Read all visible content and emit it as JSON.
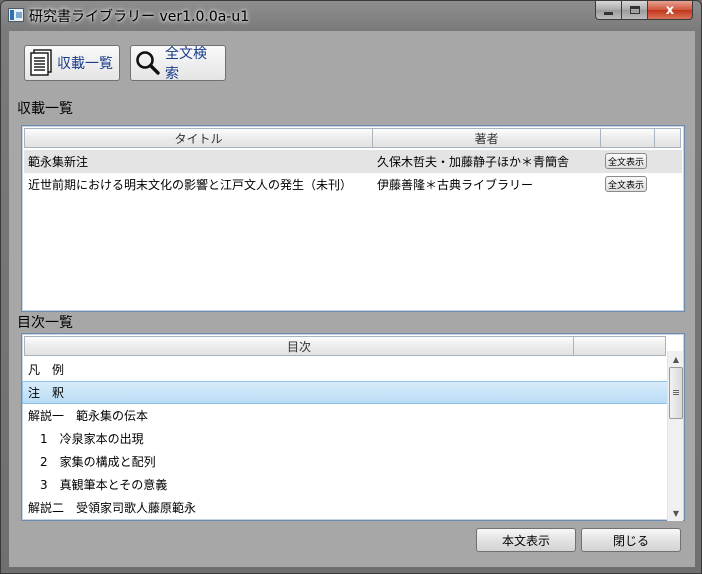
{
  "window": {
    "title": "研究書ライブラリー ver1.0.0a-u1",
    "close_glyph": "x"
  },
  "toolbar": {
    "list_label": "収載一覧",
    "search_label": "全文検索"
  },
  "collection": {
    "label": "収載一覧",
    "columns": [
      "タイトル",
      "著者"
    ],
    "rows": [
      {
        "title": "範永集新注",
        "author": "久保木哲夫・加藤静子ほか＊青簡舎",
        "button": "全文表示"
      },
      {
        "title": "近世前期における明末文化の影響と江戸文人の発生（未刊）",
        "author": "伊藤善隆＊古典ライブラリー",
        "button": "全文表示"
      }
    ]
  },
  "toc": {
    "label": "目次一覧",
    "column": "目次",
    "items": [
      "凡　例",
      "注　釈",
      "解説一　範永集の伝本",
      "　1　冷泉家本の出現",
      "　2　家集の構成と配列",
      "　3　真観筆本とその意義",
      "解説二　受領家司歌人藤原範永"
    ],
    "selected_index": 1
  },
  "footer": {
    "body_button": "本文表示",
    "close_button": "閉じる"
  }
}
